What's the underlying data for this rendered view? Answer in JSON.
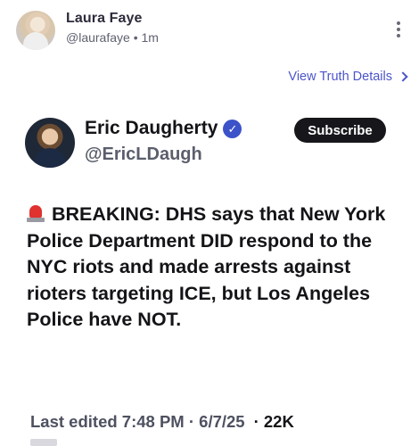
{
  "post": {
    "author_name": "Laura Faye",
    "author_handle": "@laurafaye",
    "separator": "•",
    "time": "1m",
    "details_link": "View Truth Details"
  },
  "embed": {
    "name": "Eric Daugherty",
    "verified_mark": "✓",
    "handle": "@EricLDaugh",
    "subscribe_label": "Subscribe",
    "body": "BREAKING: DHS says that New York Police Department DID respond to the NYC riots and made arrests against rioters targeting ICE, but Los Angeles Police have NOT.",
    "edited": "Last edited 7:48 PM · 6/7/25",
    "views": "· 22K"
  },
  "icons": {
    "more": "more-vertical-icon",
    "chevron": "chevron-right-icon",
    "verified": "verified-badge-icon",
    "siren": "siren-emoji"
  },
  "colors": {
    "link": "#4c55c9",
    "verified": "#3c52c9",
    "subscribe_bg": "#16161b",
    "siren": "#e0322f"
  }
}
